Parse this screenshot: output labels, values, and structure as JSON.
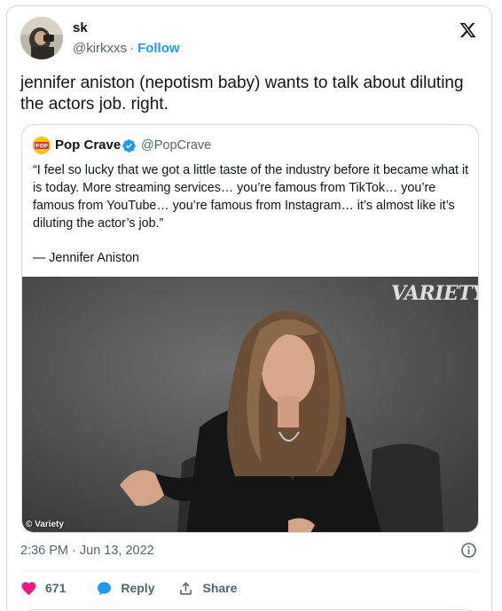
{
  "author": {
    "name": "sk",
    "handle": "@kirkxxs",
    "separator": "·",
    "follow_label": "Follow"
  },
  "tweet_text": "jennifer aniston (nepotism baby) wants to talk about diluting the actors job. right.",
  "quote": {
    "name": "Pop Crave",
    "handle": "@PopCrave",
    "avatar_text": "POP",
    "text": "“I feel so lucky that we got a little taste of the industry before it became what it is today. More streaming services… you’re famous from TikTok… you’re famous from YouTube… you’re famous from Instagram… it’s almost like it’s diluting the actor’s job.”",
    "attribution": "— Jennifer Aniston",
    "media": {
      "watermark": "VARIETY",
      "credit": "© Variety"
    }
  },
  "timestamp": "2:36 PM · Jun 13, 2022",
  "actions": {
    "likes": "671",
    "reply_label": "Reply",
    "share_label": "Share"
  },
  "colors": {
    "accent": "#1d9bf0",
    "like": "#f91880",
    "muted": "#536471"
  }
}
